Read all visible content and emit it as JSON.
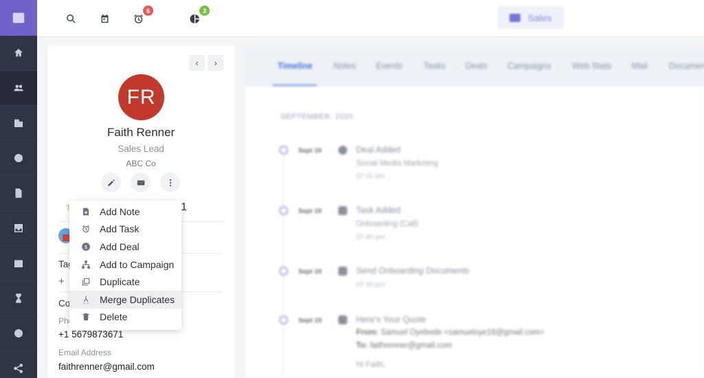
{
  "top_bar": {
    "alarm_badge": "6",
    "pie_badge": "3",
    "workspace": "Sales"
  },
  "contact": {
    "initials": "FR",
    "name": "Faith Renner",
    "title": "Sales Lead",
    "company": "ABC Co",
    "partial_tags_label": "Tag",
    "partial_contact_label": "Co",
    "partial_phone_label": "Pho",
    "partial_badge_suffix": "1",
    "phone": "+1 5679873671",
    "email_label": "Email Address",
    "email": "faithrenner@gmail.com"
  },
  "menu": {
    "items": [
      {
        "label": "Add Note",
        "icon": "note-add-icon"
      },
      {
        "label": "Add Task",
        "icon": "alarm-icon"
      },
      {
        "label": "Add Deal",
        "icon": "dollar-icon"
      },
      {
        "label": "Add to Campaign",
        "icon": "hierarchy-icon"
      },
      {
        "label": "Duplicate",
        "icon": "duplicate-icon"
      },
      {
        "label": "Merge Duplicates",
        "icon": "merge-icon"
      },
      {
        "label": "Delete",
        "icon": "trash-icon"
      }
    ],
    "hovered": "Merge Duplicates"
  },
  "timeline": {
    "tabs": [
      "Timeline",
      "Notes",
      "Events",
      "Tasks",
      "Deals",
      "Campaigns",
      "Web Stats",
      "Mail",
      "Documents"
    ],
    "active_tab": "Timeline",
    "month": "SEPTEMBER, 2025",
    "entries": [
      {
        "date": "Sept 19",
        "title": "Deal Added",
        "subtitle": "Social Media Marketing",
        "time": "07:41 pm"
      },
      {
        "date": "Sept 19",
        "title": "Task Added",
        "subtitle": "Onboarding (Call)",
        "time": "07:40 pm"
      },
      {
        "date": "Sept 19",
        "title": "Send Onboarding Documents",
        "subtitle": "",
        "time": "07:40 pm"
      },
      {
        "date": "Sept 19",
        "title": "Here's Your Quote",
        "from_label": "From:",
        "from": "Samuel Oyebode <samueloye16@gmail.com>",
        "to_label": "To:",
        "to": "faithrenner@gmail.com",
        "body": "Hi Faith,"
      }
    ]
  }
}
